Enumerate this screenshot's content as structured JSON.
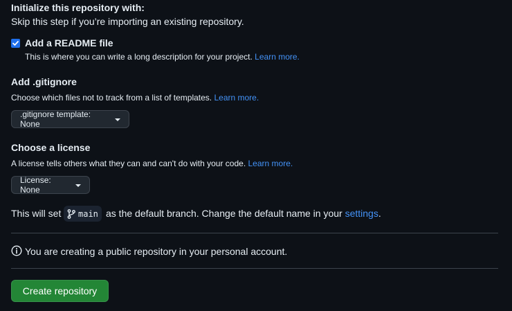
{
  "init": {
    "title": "Initialize this repository with:",
    "subtitle": "Skip this step if you’re importing an existing repository."
  },
  "readme": {
    "checked": true,
    "label": "Add a README file",
    "description": "This is where you can write a long description for your project.",
    "link": "Learn more."
  },
  "gitignore": {
    "title": "Add .gitignore",
    "description": "Choose which files not to track from a list of templates.",
    "link": "Learn more.",
    "button_label": ".gitignore template: None"
  },
  "license": {
    "title": "Choose a license",
    "description": "A license tells others what they can and can't do with your code.",
    "link": "Learn more.",
    "button_label": "License: None"
  },
  "branch": {
    "prefix": "This will set",
    "name": "main",
    "suffix": "as the default branch. Change the default name in your",
    "settings_link": "settings",
    "period": "."
  },
  "notice": {
    "text": "You are creating a public repository in your personal account.",
    "icon": "info-icon"
  },
  "actions": {
    "create_label": "Create repository"
  },
  "colors": {
    "background": "#0d1117",
    "link": "#4493f8",
    "primary_button": "#238636",
    "checkbox": "#1f6feb"
  }
}
